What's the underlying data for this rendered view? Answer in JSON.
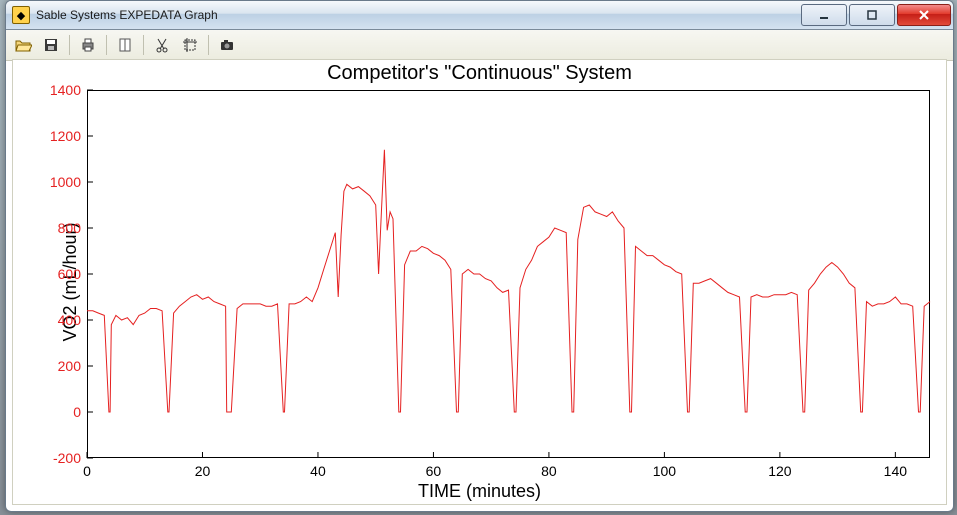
{
  "window": {
    "title": "Sable Systems EXPEDATA Graph"
  },
  "toolbar": {
    "open": "open-icon",
    "save": "save-icon",
    "print": "print-icon",
    "book": "page-setup-icon",
    "cut": "cut-icon",
    "crop": "crop-icon",
    "camera": "camera-icon"
  },
  "chart_data": {
    "type": "line",
    "title": "Competitor's \"Continuous\" System",
    "xlabel": "TIME (minutes)",
    "ylabel": "VO2 (mL/hour)",
    "xlim": [
      0,
      146
    ],
    "ylim": [
      -200,
      1400
    ],
    "xticks": [
      0,
      20,
      40,
      60,
      80,
      100,
      120,
      140
    ],
    "yticks": [
      -200,
      0,
      200,
      400,
      600,
      800,
      1000,
      1200,
      1400
    ],
    "series": [
      {
        "name": "VO2",
        "color": "#e52020",
        "x": [
          0,
          1,
          2,
          3,
          3.8,
          4,
          4.2,
          5,
          6,
          7,
          8,
          9,
          10,
          11,
          12,
          13,
          14,
          14.2,
          15,
          16,
          17,
          18,
          19,
          20,
          21,
          22,
          23,
          24,
          24.2,
          25,
          26,
          27,
          28,
          29,
          30,
          31,
          32,
          33,
          34,
          34.2,
          35,
          36,
          37,
          38,
          39,
          40,
          41,
          42,
          43,
          43.5,
          44,
          44.5,
          45,
          46,
          47,
          48,
          49,
          50,
          50.5,
          51,
          51.5,
          52,
          52.5,
          53,
          54,
          54.3,
          55,
          56,
          57,
          58,
          59,
          60,
          61,
          62,
          63,
          64,
          64.3,
          65,
          66,
          67,
          68,
          69,
          70,
          71,
          72,
          73,
          74,
          74.3,
          75,
          76,
          77,
          78,
          79,
          80,
          81,
          82,
          83,
          84,
          84.3,
          85,
          86,
          87,
          88,
          89,
          90,
          91,
          92,
          93,
          94,
          94.3,
          95,
          96,
          97,
          98,
          99,
          100,
          101,
          102,
          103,
          104,
          104.3,
          105,
          106,
          107,
          108,
          109,
          110,
          111,
          112,
          113,
          114,
          114.3,
          115,
          116,
          117,
          118,
          119,
          120,
          121,
          122,
          123,
          124,
          124.3,
          125,
          126,
          127,
          128,
          129,
          130,
          131,
          132,
          133,
          134,
          134.3,
          135,
          136,
          137,
          138,
          139,
          140,
          141,
          142,
          143,
          144,
          144.3,
          145,
          146
        ],
        "y": [
          440,
          440,
          430,
          420,
          0,
          0,
          380,
          420,
          400,
          410,
          380,
          420,
          430,
          450,
          450,
          440,
          0,
          0,
          430,
          460,
          480,
          500,
          510,
          490,
          500,
          480,
          470,
          460,
          0,
          0,
          450,
          470,
          470,
          470,
          470,
          460,
          460,
          470,
          0,
          0,
          470,
          470,
          480,
          500,
          480,
          540,
          620,
          700,
          780,
          500,
          770,
          960,
          990,
          970,
          980,
          960,
          940,
          900,
          600,
          880,
          1140,
          790,
          870,
          840,
          0,
          0,
          640,
          700,
          700,
          720,
          710,
          690,
          680,
          660,
          620,
          0,
          0,
          600,
          620,
          600,
          600,
          580,
          570,
          540,
          520,
          530,
          0,
          0,
          540,
          620,
          660,
          720,
          740,
          760,
          800,
          790,
          780,
          0,
          0,
          750,
          890,
          900,
          870,
          860,
          850,
          870,
          830,
          800,
          0,
          0,
          720,
          700,
          680,
          680,
          660,
          640,
          630,
          610,
          600,
          0,
          0,
          560,
          560,
          570,
          580,
          560,
          540,
          520,
          510,
          500,
          0,
          0,
          500,
          510,
          500,
          500,
          510,
          510,
          510,
          520,
          510,
          0,
          0,
          530,
          560,
          600,
          630,
          650,
          630,
          600,
          560,
          540,
          0,
          0,
          480,
          460,
          470,
          470,
          480,
          500,
          470,
          470,
          460,
          0,
          0,
          460,
          480
        ]
      }
    ]
  }
}
